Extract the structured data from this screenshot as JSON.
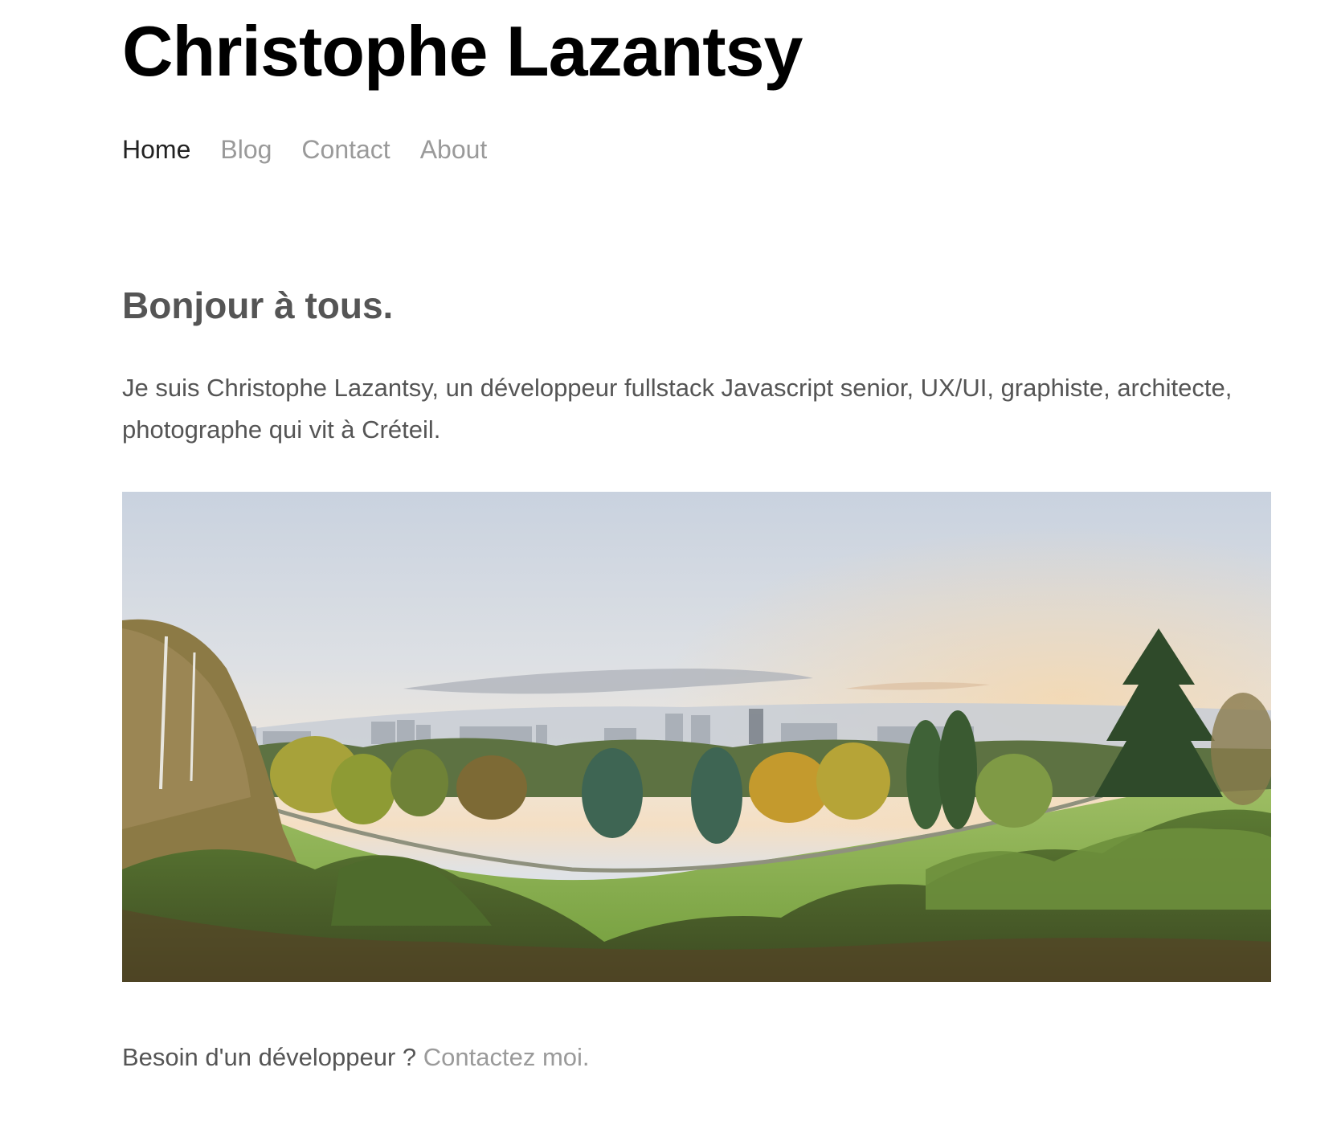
{
  "header": {
    "site_title": "Christophe Lazantsy",
    "nav": [
      {
        "label": "Home",
        "active": true
      },
      {
        "label": "Blog",
        "active": false
      },
      {
        "label": "Contact",
        "active": false
      },
      {
        "label": "About",
        "active": false
      }
    ]
  },
  "main": {
    "heading": "Bonjour à tous.",
    "intro": "Je suis Christophe Lazantsy, un développeur fullstack Javascript senior, UX/UI, graphiste, architecte, photographe qui vit à Créteil.",
    "photo": {
      "kind": "panoramic landscape photo of an autumn park with a city skyline"
    },
    "cta_text": "Besoin d'un développeur ? ",
    "cta_link": "Contactez moi."
  },
  "colors": {
    "title": "#000000",
    "text": "#555555",
    "nav_active": "#222222",
    "link": "#9a9a9a"
  }
}
